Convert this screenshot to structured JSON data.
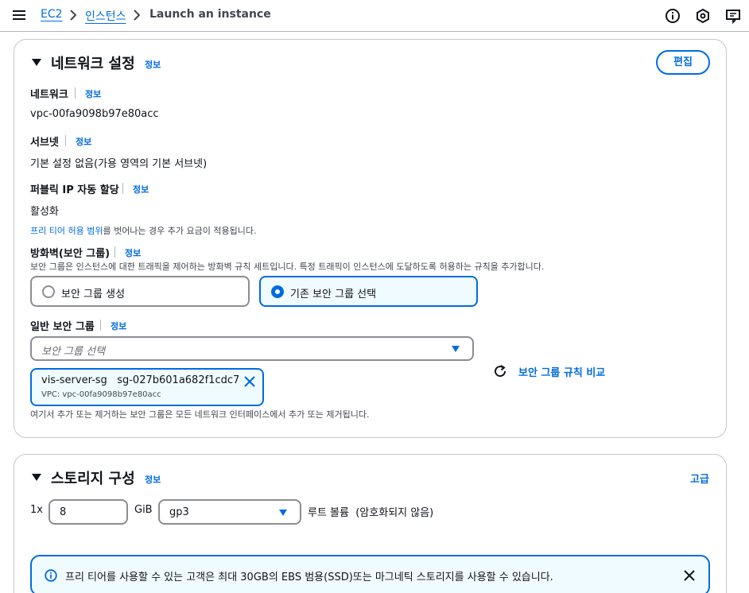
{
  "breadcrumb": {
    "items": [
      "EC2",
      "인스턴스"
    ],
    "current": "Launch an instance"
  },
  "top_icons": [
    "info-circle-icon",
    "settings-hexagon-icon",
    "feedback-icon"
  ],
  "network": {
    "title": "네트워크 설정",
    "info": "정보",
    "edit_label": "편집",
    "network_label": "네트워크",
    "network_value": "vpc-00fa9098b97e80acc",
    "subnet_label": "서브넷",
    "subnet_value": "기본 설정 없음(가용 영역의 기본 서브넷)",
    "public_ip_label": "퍼블릭 IP 자동 할당",
    "public_ip_value": "활성화",
    "free_tier_link": "프리 티어 허용 범위",
    "free_tier_note": "를 벗어나는 경우 추가 요금이 적용됩니다.",
    "firewall_label": "방화벽(보안 그룹)",
    "firewall_desc": "보안 그룹은 인스턴스에 대한 트래픽을 제어하는 방화벽 규칙 세트입니다. 특정 트래픽이 인스턴스에 도달하도록 허용하는 규칙을 추가합니다.",
    "option_create": "보안 그룹 생성",
    "option_existing": "기존 보안 그룹 선택",
    "common_sg_label": "일반 보안 그룹",
    "select_placeholder": "보안 그룹 선택",
    "selected_sg_name": "vis-server-sg",
    "selected_sg_id": "sg-027b601a682f1cdc7",
    "selected_sg_vpc": "VPC: vpc-00fa9098b97e80acc",
    "compare_label": "보안 그룹 규칙 비교",
    "sg_note": "여기서 추가 또는 제거하는 보안 그룹은 모든 네트워크 인터페이스에서 추가 또는 제거됩니다."
  },
  "storage": {
    "title": "스토리지 구성",
    "info": "정보",
    "advanced_label": "고급",
    "count_prefix": "1x",
    "size_value": "8",
    "size_unit": "GiB",
    "volume_type": "gp3",
    "root_volume_label": "루트 볼륨  (암호화되지 않음)",
    "alert_text": "프리 티어를 사용할 수 있는 고객은 최대 30GB의 EBS 범용(SSD)또는 마그네틱 스토리지를 사용할 수 있습니다."
  },
  "colors": {
    "link": "#006ce0",
    "selected_bg": "#f0fbff",
    "border": "#c6c6cd",
    "text": "#0f141a"
  }
}
